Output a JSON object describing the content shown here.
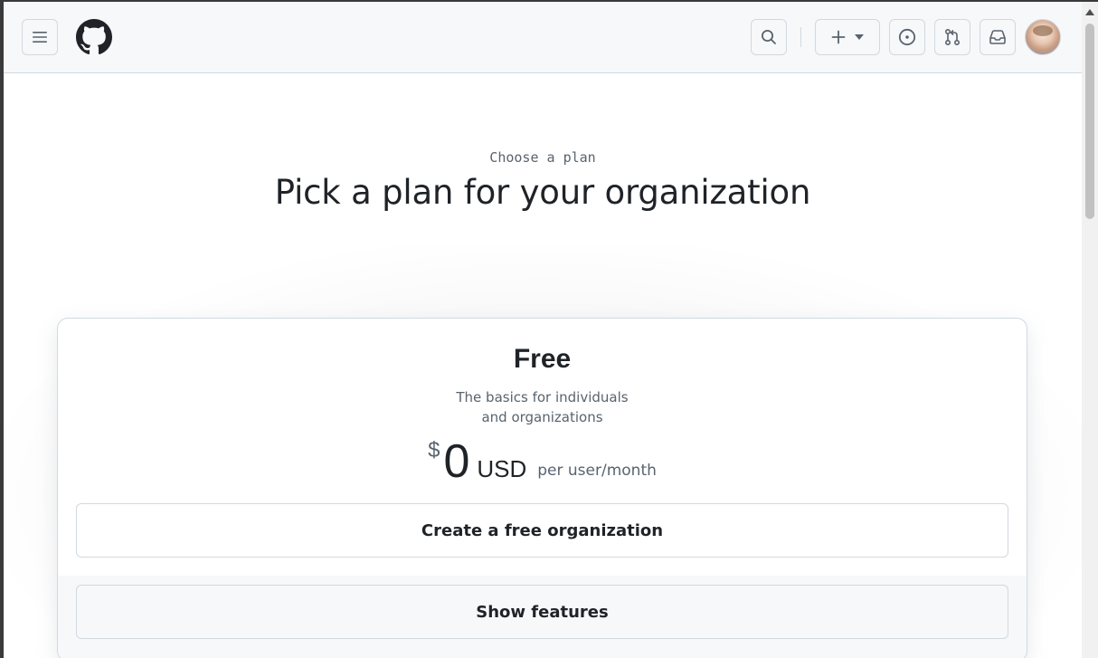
{
  "header": {
    "menu_icon": "hamburger-menu-icon",
    "logo_icon": "github-octocat-icon",
    "search_icon": "search-icon",
    "create_icon": "plus-icon",
    "create_caret_icon": "triangle-down-icon",
    "issues_icon": "issue-opened-icon",
    "pulls_icon": "git-pull-request-icon",
    "inbox_icon": "inbox-icon",
    "avatar": "user-avatar"
  },
  "main": {
    "eyebrow": "Choose a plan",
    "title": "Pick a plan for your organization"
  },
  "plan": {
    "name": "Free",
    "description_line1": "The basics for individuals",
    "description_line2": "and organizations",
    "currency_symbol": "$",
    "price": "0",
    "currency": "USD",
    "period": "per user/month",
    "cta_label": "Create a free organization",
    "features_label": "Show features"
  },
  "colors": {
    "text_primary": "#1f2328",
    "text_muted": "#59636e",
    "border": "#d1d9e0",
    "header_bg": "#f6f8fa"
  }
}
